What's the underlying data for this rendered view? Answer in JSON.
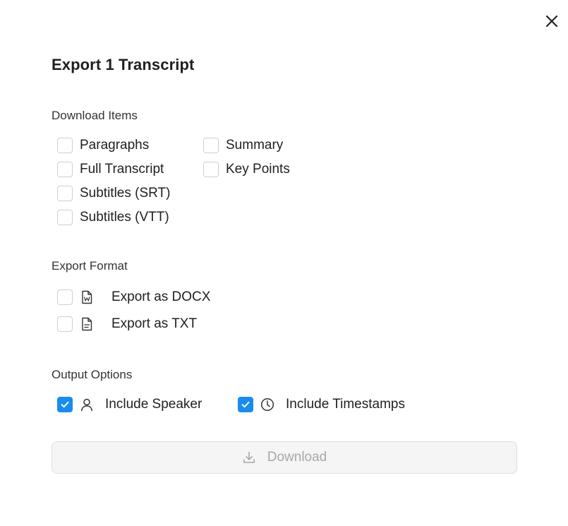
{
  "dialog": {
    "title": "Export 1 Transcript"
  },
  "download_items": {
    "label": "Download Items",
    "options": [
      {
        "label": "Paragraphs",
        "checked": false
      },
      {
        "label": "Full Transcript",
        "checked": false
      },
      {
        "label": "Subtitles (SRT)",
        "checked": false
      },
      {
        "label": "Subtitles (VTT)",
        "checked": false
      },
      {
        "label": "Summary",
        "checked": false
      },
      {
        "label": "Key Points",
        "checked": false
      }
    ]
  },
  "export_format": {
    "label": "Export Format",
    "options": [
      {
        "label": "Export as DOCX",
        "icon": "docx-file-icon",
        "checked": false
      },
      {
        "label": "Export as TXT",
        "icon": "txt-file-icon",
        "checked": false
      }
    ]
  },
  "output_options": {
    "label": "Output Options",
    "options": [
      {
        "label": "Include Speaker",
        "icon": "user-icon",
        "checked": true
      },
      {
        "label": "Include Timestamps",
        "icon": "clock-icon",
        "checked": true
      }
    ]
  },
  "download_button": {
    "label": "Download",
    "icon": "download-icon",
    "disabled": true
  },
  "colors": {
    "accent": "#1a8cf0",
    "disabled_text": "#a8a8a8"
  }
}
